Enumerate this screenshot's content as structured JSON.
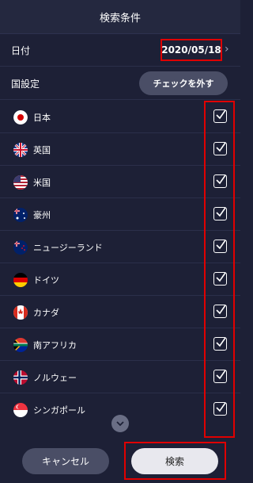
{
  "header": {
    "title": "検索条件"
  },
  "date": {
    "label": "日付",
    "value": "2020/05/18"
  },
  "country": {
    "label": "国設定",
    "uncheck_button": "チェックを外す"
  },
  "countries": [
    {
      "name": "日本",
      "checked": true
    },
    {
      "name": "英国",
      "checked": true
    },
    {
      "name": "米国",
      "checked": true
    },
    {
      "name": "豪州",
      "checked": true
    },
    {
      "name": "ニュージーランド",
      "checked": true
    },
    {
      "name": "ドイツ",
      "checked": true
    },
    {
      "name": "カナダ",
      "checked": true
    },
    {
      "name": "南アフリカ",
      "checked": true
    },
    {
      "name": "ノルウェー",
      "checked": true
    },
    {
      "name": "シンガポール",
      "checked": true
    }
  ],
  "footer": {
    "cancel_label": "キャンセル",
    "search_label": "検索"
  },
  "colors": {
    "background": "#1d2036",
    "highlight": "#e00000"
  }
}
